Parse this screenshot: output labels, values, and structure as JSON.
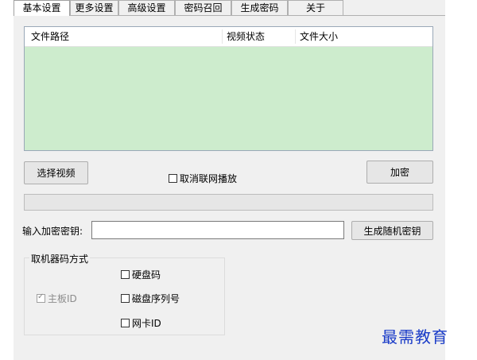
{
  "tabs": [
    {
      "label": "基本设置",
      "active": true
    },
    {
      "label": "更多设置",
      "active": false
    },
    {
      "label": "高级设置",
      "active": false
    },
    {
      "label": "密码召回",
      "active": false
    },
    {
      "label": "生成密码",
      "active": false
    },
    {
      "label": "关于",
      "active": false
    }
  ],
  "file_list": {
    "columns": [
      "文件路径",
      "视频状态",
      "文件大小"
    ],
    "rows": []
  },
  "buttons": {
    "select_video": "选择视频",
    "encrypt": "加密",
    "generate_random_key": "生成随机密钥"
  },
  "options": {
    "cancel_network_playback": {
      "label": "取消联网播放",
      "checked": false
    }
  },
  "progress": {
    "value": 0
  },
  "key_input": {
    "label": "输入加密密钥:",
    "value": ""
  },
  "machine_code": {
    "title": "取机器码方式",
    "mainboard_id": {
      "label": "主板ID",
      "checked": true,
      "enabled": false
    },
    "disk_code": {
      "label": "硬盘码",
      "checked": false
    },
    "disk_serial": {
      "label": "磁盘序列号",
      "checked": false
    },
    "nic_id": {
      "label": "网卡ID",
      "checked": false
    }
  },
  "watermark": "最需教育",
  "colors": {
    "list_background": "#cdeccd",
    "watermark": "#1a3cc8",
    "window_background": "#f0f0f0"
  }
}
